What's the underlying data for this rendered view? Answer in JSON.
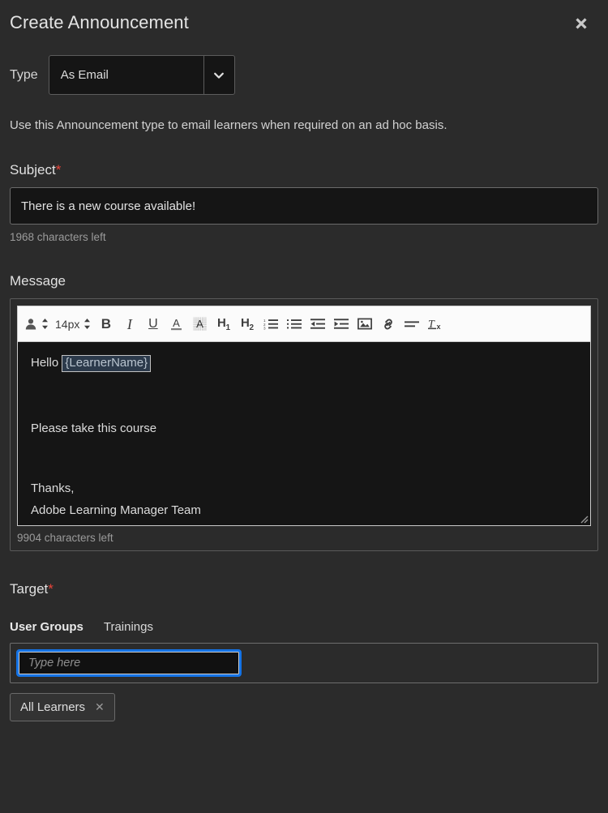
{
  "dialog": {
    "title": "Create Announcement",
    "close_icon": "close-icon"
  },
  "type_field": {
    "label": "Type",
    "selected": "As Email",
    "options": [
      "As Email"
    ],
    "chevron_icon": "chevron-down-icon"
  },
  "help_text": "Use this Announcement type to email learners when required on an ad hoc basis.",
  "subject": {
    "label": "Subject",
    "required_marker": "*",
    "value": "There is a new course available!",
    "placeholder": "",
    "characters_left": "1968 characters left"
  },
  "message": {
    "label": "Message",
    "toolbar": [
      {
        "name": "insert-placeholder-icon",
        "kind": "icon-stepper",
        "glyph": "person"
      },
      {
        "name": "font-size-stepper",
        "kind": "label-stepper",
        "label": "14px"
      },
      {
        "name": "bold-button",
        "kind": "text",
        "glyph": "B",
        "style": "bold"
      },
      {
        "name": "italic-button",
        "kind": "text",
        "glyph": "I",
        "style": "ital"
      },
      {
        "name": "underline-button",
        "kind": "text",
        "glyph": "U",
        "style": "under"
      },
      {
        "name": "text-color-button",
        "kind": "text-color",
        "glyph": "A"
      },
      {
        "name": "highlight-color-button",
        "kind": "highlight",
        "glyph": "A"
      },
      {
        "name": "heading-1-button",
        "kind": "heading",
        "glyph": "H",
        "sub": "1"
      },
      {
        "name": "heading-2-button",
        "kind": "heading",
        "glyph": "H",
        "sub": "2"
      },
      {
        "name": "ordered-list-button",
        "kind": "ordered-list"
      },
      {
        "name": "unordered-list-button",
        "kind": "unordered-list"
      },
      {
        "name": "outdent-button",
        "kind": "outdent"
      },
      {
        "name": "indent-button",
        "kind": "indent"
      },
      {
        "name": "insert-image-button",
        "kind": "image"
      },
      {
        "name": "insert-link-button",
        "kind": "link"
      },
      {
        "name": "align-button",
        "kind": "align"
      },
      {
        "name": "clear-format-button",
        "kind": "clear-format"
      }
    ],
    "body": {
      "greeting_prefix": "Hello ",
      "token": "{LearnerName}",
      "line_2": "Please take this course",
      "line_3": "Thanks,",
      "line_4": "Adobe Learning Manager Team"
    },
    "characters_left": "9904 characters left",
    "resize_handle_icon": "resize-handle-icon"
  },
  "target": {
    "label": "Target",
    "required_marker": "*",
    "tabs": [
      {
        "label": "User Groups",
        "active": true
      },
      {
        "label": "Trainings",
        "active": false
      }
    ],
    "input_placeholder": "Type here",
    "input_value": "",
    "chips": [
      {
        "label": "All Learners",
        "remove_icon": "close-icon"
      }
    ]
  },
  "colors": {
    "background": "#2b2b2b",
    "field_background": "#151515",
    "accent_focus": "#1473e6",
    "required_red": "#e8443a",
    "toolbar_background": "#fbfbfb",
    "token_background": "#2c3a4b"
  }
}
